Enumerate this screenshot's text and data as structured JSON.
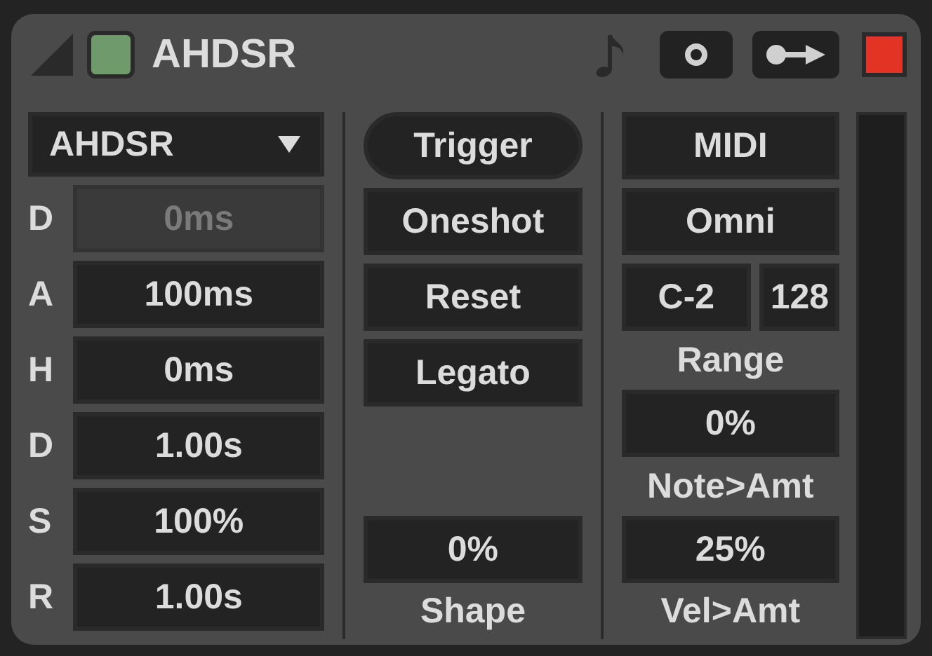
{
  "header": {
    "enabled": true,
    "title": "AHDSR",
    "armed": true
  },
  "envelope": {
    "mode": "AHDSR",
    "params": [
      {
        "label": "D",
        "value": "0ms",
        "disabled": true
      },
      {
        "label": "A",
        "value": "100ms",
        "disabled": false
      },
      {
        "label": "H",
        "value": "0ms",
        "disabled": false
      },
      {
        "label": "D",
        "value": "1.00s",
        "disabled": false
      },
      {
        "label": "S",
        "value": "100%",
        "disabled": false
      },
      {
        "label": "R",
        "value": "1.00s",
        "disabled": false
      }
    ]
  },
  "modes": {
    "buttons": [
      {
        "label": "Trigger",
        "kind": "pill"
      },
      {
        "label": "Oneshot",
        "kind": "square"
      },
      {
        "label": "Reset",
        "kind": "square"
      },
      {
        "label": "Legato",
        "kind": "square"
      }
    ],
    "shape": {
      "value": "0%",
      "label": "Shape"
    }
  },
  "midi": {
    "source": "MIDI",
    "channel": "Omni",
    "range": {
      "low": "C-2",
      "high": "128",
      "label": "Range"
    },
    "note_amount": {
      "value": "0%",
      "label": "Note>Amt"
    },
    "velocity_amount": {
      "value": "25%",
      "label": "Vel>Amt"
    }
  }
}
